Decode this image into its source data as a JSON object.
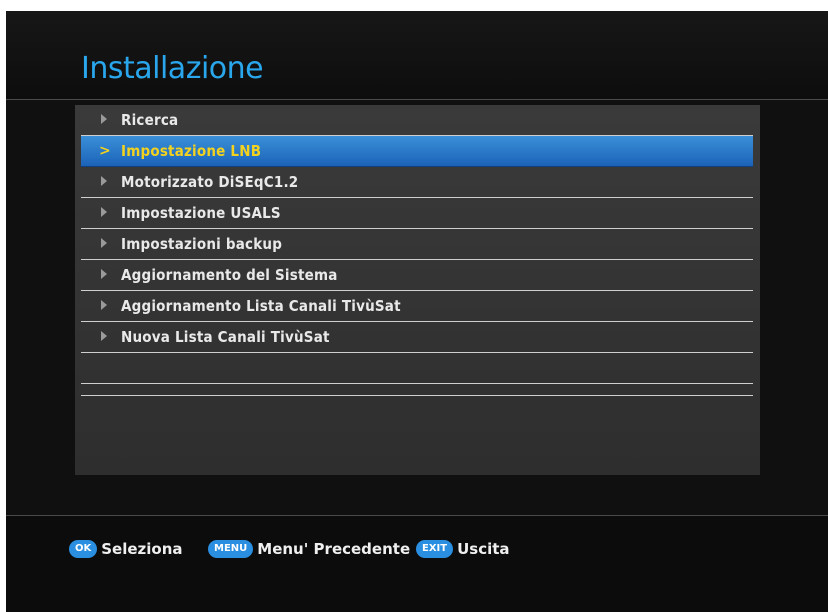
{
  "header": {
    "title": "Installazione"
  },
  "menu": {
    "items": [
      {
        "label": "Ricerca",
        "selected": false
      },
      {
        "label": "Impostazione LNB",
        "selected": true
      },
      {
        "label": "Motorizzato DiSEqC1.2",
        "selected": false
      },
      {
        "label": "Impostazione USALS",
        "selected": false
      },
      {
        "label": "Impostazioni backup",
        "selected": false
      },
      {
        "label": "Aggiornamento del Sistema",
        "selected": false
      },
      {
        "label": "Aggiornamento Lista Canali TivùSat",
        "selected": false
      },
      {
        "label": "Nuova Lista Canali TivùSat",
        "selected": false
      }
    ]
  },
  "footer": {
    "ok_key": "OK",
    "ok_label": "Seleziona",
    "menu_key": "MENU",
    "menu_label": "Menu' Precedente",
    "exit_key": "EXIT",
    "exit_label": "Uscita"
  },
  "colors": {
    "title": "#2aa6ec",
    "selected_bg": "#2a7fd0",
    "selected_text": "#f2d21e",
    "key_button": "#2a8fe0"
  }
}
